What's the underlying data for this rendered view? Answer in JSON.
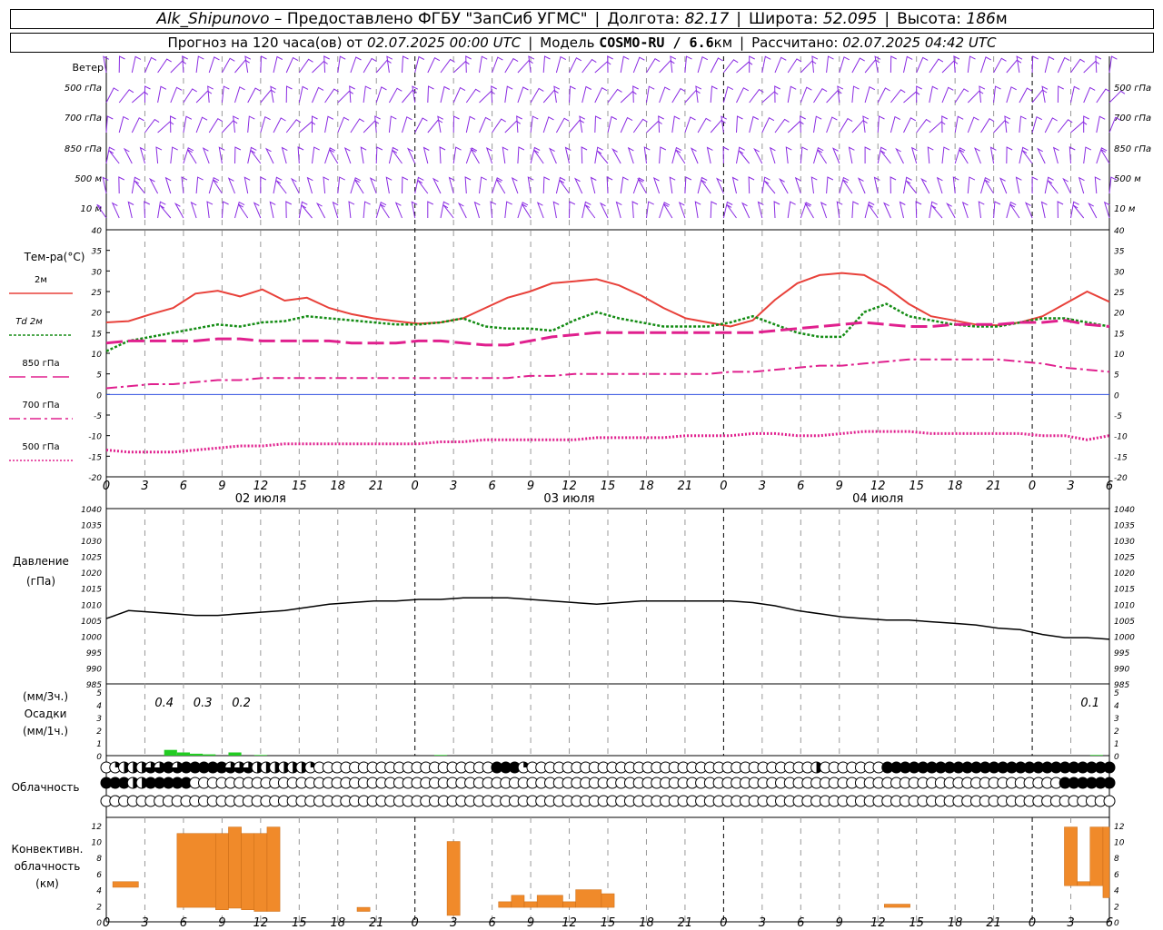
{
  "header": {
    "station": "Alk_Shipunovo",
    "provided_by": "– Предоставлено ФГБУ \"ЗапСиб УГМС\"",
    "lon_label": "Долгота:",
    "lon_value": "82.17",
    "lat_label": "Широта:",
    "lat_value": "52.095",
    "alt_label": "Высота:",
    "alt_value": "186",
    "alt_unit": "м",
    "forecast_prefix": "Прогноз на 120 часа(ов) от",
    "forecast_from": "02.07.2025 00:00 UTC",
    "model_label": "Модель",
    "model_value": "COSMO-RU / 6.6",
    "model_unit": "км",
    "calc_label": "Рассчитано:",
    "calc_value": "02.07.2025 04:42 UTC"
  },
  "chart_data": {
    "type": "line",
    "x_unit": "hour UTC from 02.07.2025 00:00",
    "x_range": [
      0,
      78
    ],
    "x_tick_labels": [
      "0",
      "3",
      "6",
      "9",
      "12",
      "15",
      "18",
      "21",
      "0",
      "3",
      "6",
      "9",
      "12",
      "15",
      "18",
      "21",
      "0",
      "3",
      "6",
      "9",
      "12",
      "15",
      "18",
      "21",
      "0",
      "3",
      "6"
    ],
    "date_labels": [
      "02 июля",
      "03 июля",
      "04 июля"
    ],
    "wind": {
      "label": "Ветер",
      "levels": [
        "500 гПа",
        "700 гПа",
        "850 гПа",
        "500 м",
        "10  м"
      ]
    },
    "temperature": {
      "ylabel": "Тем-ра(°С)",
      "ylim": [
        -20,
        40
      ],
      "yticks": [
        "40",
        "35",
        "30",
        "25",
        "20",
        "15",
        "10",
        "5",
        "0",
        "-5",
        "-10",
        "-15",
        "-20"
      ],
      "series": [
        {
          "name": "2м",
          "color": "#e8413a",
          "values": [
            17.5,
            17.8,
            19.5,
            21,
            24.5,
            25.2,
            23.8,
            25.5,
            22.8,
            23.5,
            21,
            19.5,
            18.5,
            17.8,
            17.2,
            17.5,
            18.5,
            21,
            23.5,
            25,
            27,
            27.5,
            28,
            26.5,
            24,
            21,
            18.5,
            17.5,
            16.5,
            18,
            23,
            27,
            29,
            29.5,
            29,
            26,
            22,
            19,
            18,
            17,
            16.8,
            17.5,
            19,
            22,
            25,
            22.5
          ]
        },
        {
          "name": "Td 2м",
          "color": "#148c14",
          "values": [
            10.5,
            13,
            14,
            15,
            16,
            17,
            16.5,
            17.5,
            17.8,
            19,
            18.5,
            18,
            17.5,
            17,
            17,
            17.5,
            18.5,
            16.5,
            16,
            16,
            15.5,
            18,
            20,
            18.5,
            17.5,
            16.5,
            16.5,
            16.5,
            17.5,
            19,
            17,
            15,
            14,
            14,
            20,
            22,
            19,
            18,
            17,
            16.5,
            16.5,
            17.5,
            18.5,
            18.5,
            17.5,
            16.5
          ]
        },
        {
          "name": "850 гПа",
          "color": "#e0208e",
          "values": [
            12.5,
            13,
            13,
            13,
            13,
            13.5,
            13.5,
            13,
            13,
            13,
            13,
            12.5,
            12.5,
            12.5,
            13,
            13,
            12.5,
            12,
            12,
            13,
            14,
            14.5,
            15,
            15,
            15,
            15,
            15,
            15,
            15,
            15,
            15.5,
            16,
            16.5,
            17,
            17.5,
            17,
            16.5,
            16.5,
            17,
            17,
            17,
            17.5,
            17.5,
            18,
            17,
            16.5
          ]
        },
        {
          "name": "700 гПа",
          "color": "#e0208e",
          "values": [
            1.5,
            2,
            2.5,
            2.5,
            3,
            3.5,
            3.5,
            4,
            4,
            4,
            4,
            4,
            4,
            4,
            4,
            4,
            4,
            4,
            4,
            4.5,
            4.5,
            5,
            5,
            5,
            5,
            5,
            5,
            5,
            5.5,
            5.5,
            6,
            6.5,
            7,
            7,
            7.5,
            8,
            8.5,
            8.5,
            8.5,
            8.5,
            8.5,
            8,
            7.5,
            6.5,
            6,
            5.5
          ]
        },
        {
          "name": "500 гПа",
          "color": "#e0208e",
          "values": [
            -13.5,
            -14,
            -14,
            -14,
            -13.5,
            -13,
            -12.5,
            -12.5,
            -12,
            -12,
            -12,
            -12,
            -12,
            -12,
            -12,
            -11.5,
            -11.5,
            -11,
            -11,
            -11,
            -11,
            -11,
            -10.5,
            -10.5,
            -10.5,
            -10.5,
            -10,
            -10,
            -10,
            -9.5,
            -9.5,
            -10,
            -10,
            -9.5,
            -9,
            -9,
            -9,
            -9.5,
            -9.5,
            -9.5,
            -9.5,
            -9.5,
            -10,
            -10,
            -11,
            -10
          ]
        }
      ]
    },
    "pressure": {
      "ylabel": "Давление",
      "unit": "(гПа)",
      "ylim": [
        985,
        1040
      ],
      "yticks": [
        "1040",
        "1035",
        "1030",
        "1025",
        "1020",
        "1015",
        "1010",
        "1005",
        "1000",
        "995",
        "990",
        "985"
      ],
      "values": [
        1005.5,
        1008,
        1007.5,
        1007,
        1006.5,
        1006.5,
        1007,
        1007.5,
        1008,
        1009,
        1010,
        1010.5,
        1011,
        1011,
        1011.5,
        1011.5,
        1012,
        1012,
        1012,
        1011.5,
        1011,
        1010.5,
        1010,
        1010.5,
        1011,
        1011,
        1011,
        1011,
        1011,
        1010.5,
        1009.5,
        1008,
        1007,
        1006,
        1005.5,
        1005,
        1005,
        1004.5,
        1004,
        1003.5,
        1002.5,
        1002,
        1000.5,
        999.5,
        999.5,
        999
      ]
    },
    "precipitation": {
      "ylabel": "Осадки",
      "unit_3h": "(мм/3ч.)",
      "unit_1h": "(мм/1ч.)",
      "ylim": [
        0,
        5
      ],
      "yticks": [
        "5",
        "4",
        "3",
        "2",
        "1",
        "0"
      ],
      "labels_3h": [
        {
          "x": 4.5,
          "text": "0.4"
        },
        {
          "x": 7.5,
          "text": "0.3"
        },
        {
          "x": 10.5,
          "text": "0.2"
        },
        {
          "x": 76.5,
          "text": "0.1"
        }
      ],
      "bars_1h": [
        {
          "x": 5,
          "v": 0.45
        },
        {
          "x": 6,
          "v": 0.25
        },
        {
          "x": 7,
          "v": 0.15
        },
        {
          "x": 8,
          "v": 0.1
        },
        {
          "x": 10,
          "v": 0.25
        },
        {
          "x": 12,
          "v": 0.05
        },
        {
          "x": 26,
          "v": 0.05
        },
        {
          "x": 77,
          "v": 0.05
        }
      ]
    },
    "cloudiness": {
      "label": "Облачность",
      "rows_code_legend": "0=clear 1=quarter 2=half 3=three-quarter 4=overcast",
      "top": [
        0,
        1,
        2,
        2,
        2,
        3,
        3,
        4,
        3,
        4,
        4,
        4,
        4,
        4,
        3,
        3,
        3,
        2,
        2,
        2,
        2,
        2,
        2,
        1,
        0,
        0,
        0,
        0,
        0,
        0,
        0,
        0,
        0,
        0,
        0,
        0,
        0,
        0,
        0,
        0,
        0,
        0,
        0,
        0,
        4,
        4,
        4,
        1,
        0,
        0,
        0,
        0,
        0,
        0,
        0,
        0,
        0,
        0,
        0,
        0,
        0,
        0,
        0,
        0,
        0,
        0,
        0,
        0,
        0,
        0,
        0,
        0,
        0,
        0,
        0,
        0,
        0,
        0,
        0,
        0,
        2,
        0,
        0,
        0,
        0,
        0,
        0,
        0,
        4,
        4,
        4,
        4,
        4,
        4,
        4,
        4,
        4,
        4,
        4,
        4,
        4,
        4,
        4,
        4,
        4,
        4,
        4,
        4,
        4,
        4,
        4,
        4,
        4,
        4
      ],
      "middle": [
        4,
        4,
        4,
        2,
        2,
        4,
        4,
        4,
        4,
        4,
        0,
        0,
        0,
        0,
        0,
        0,
        0,
        0,
        0,
        0,
        0,
        0,
        0,
        0,
        0,
        0,
        0,
        0,
        0,
        0,
        0,
        0,
        0,
        0,
        0,
        0,
        0,
        0,
        0,
        0,
        0,
        0,
        0,
        0,
        0,
        0,
        0,
        0,
        0,
        0,
        0,
        0,
        0,
        0,
        0,
        0,
        0,
        0,
        0,
        0,
        0,
        0,
        0,
        0,
        0,
        0,
        0,
        0,
        0,
        0,
        0,
        0,
        0,
        0,
        0,
        0,
        0,
        0,
        0,
        0,
        0,
        0,
        0,
        0,
        0,
        0,
        0,
        0,
        0,
        0,
        0,
        0,
        0,
        0,
        0,
        0,
        0,
        0,
        0,
        0,
        0,
        0,
        0,
        0,
        0,
        0,
        0,
        0,
        4,
        4,
        4,
        4,
        4,
        4
      ],
      "bottom": [
        0,
        0,
        0,
        0,
        0,
        0,
        0,
        0,
        0,
        0,
        0,
        0,
        0,
        0,
        0,
        0,
        0,
        0,
        0,
        0,
        0,
        0,
        0,
        0,
        0,
        0,
        0,
        0,
        0,
        0,
        0,
        0,
        0,
        0,
        0,
        0,
        0,
        0,
        0,
        0,
        0,
        0,
        0,
        0,
        0,
        0,
        0,
        0,
        0,
        0,
        0,
        0,
        0,
        0,
        0,
        0,
        0,
        0,
        0,
        0,
        0,
        0,
        0,
        0,
        0,
        0,
        0,
        0,
        0,
        0,
        0,
        0,
        0,
        0,
        0,
        0,
        0,
        0,
        0,
        0,
        0,
        0,
        0,
        0,
        0,
        0,
        0,
        0,
        0,
        0,
        0,
        0,
        0,
        0,
        0,
        0,
        0,
        0,
        0,
        0,
        0,
        0,
        0,
        0,
        0,
        0,
        0,
        0,
        0,
        0,
        0,
        0,
        0,
        0
      ]
    },
    "convective": {
      "ylabel_lines": [
        "Конвективн.",
        "облачность",
        "(км)"
      ],
      "ylim": [
        0,
        13
      ],
      "yticks": [
        "12",
        "10",
        "8",
        "6",
        "4",
        "2",
        "0"
      ],
      "bars": [
        {
          "x0": 0.5,
          "x1": 2.5,
          "b": 4.3,
          "t": 5
        },
        {
          "x0": 5.5,
          "x1": 8.5,
          "b": 1.8,
          "t": 11
        },
        {
          "x0": 8.5,
          "x1": 9.5,
          "b": 1.5,
          "t": 11
        },
        {
          "x0": 9.5,
          "x1": 10.5,
          "b": 1.7,
          "t": 11.8
        },
        {
          "x0": 10.5,
          "x1": 11.5,
          "b": 1.5,
          "t": 11
        },
        {
          "x0": 11.5,
          "x1": 12.5,
          "b": 1.3,
          "t": 11
        },
        {
          "x0": 12.5,
          "x1": 13.5,
          "b": 1.3,
          "t": 11.8
        },
        {
          "x0": 19.5,
          "x1": 20.5,
          "b": 1.3,
          "t": 1.8
        },
        {
          "x0": 26.5,
          "x1": 27.5,
          "b": 0.8,
          "t": 10
        },
        {
          "x0": 30.5,
          "x1": 31.5,
          "b": 1.8,
          "t": 2.5
        },
        {
          "x0": 31.5,
          "x1": 32.5,
          "b": 1.8,
          "t": 3.3
        },
        {
          "x0": 32.5,
          "x1": 33.5,
          "b": 1.8,
          "t": 2.5
        },
        {
          "x0": 33.5,
          "x1": 35.5,
          "b": 1.8,
          "t": 3.3
        },
        {
          "x0": 35.5,
          "x1": 36.5,
          "b": 1.8,
          "t": 2.5
        },
        {
          "x0": 36.5,
          "x1": 38.5,
          "b": 1.8,
          "t": 4
        },
        {
          "x0": 38.5,
          "x1": 39.5,
          "b": 1.8,
          "t": 3.5
        },
        {
          "x0": 60.5,
          "x1": 62.5,
          "b": 1.8,
          "t": 2.2
        },
        {
          "x0": 74.5,
          "x1": 75.5,
          "b": 4.5,
          "t": 11.8
        },
        {
          "x0": 75.5,
          "x1": 76.5,
          "b": 4.5,
          "t": 5
        },
        {
          "x0": 76.5,
          "x1": 77.5,
          "b": 4.5,
          "t": 11.8
        },
        {
          "x0": 77.5,
          "x1": 78,
          "b": 3,
          "t": 11.8
        }
      ]
    }
  },
  "colors": {
    "wind": "#8a2be2",
    "t2m": "#e8413a",
    "td": "#148c14",
    "pink": "#e0208e",
    "pressure": "#000000",
    "precip": "#22cc22",
    "convective": "#f08a2a",
    "zero_line": "#3050e0"
  }
}
